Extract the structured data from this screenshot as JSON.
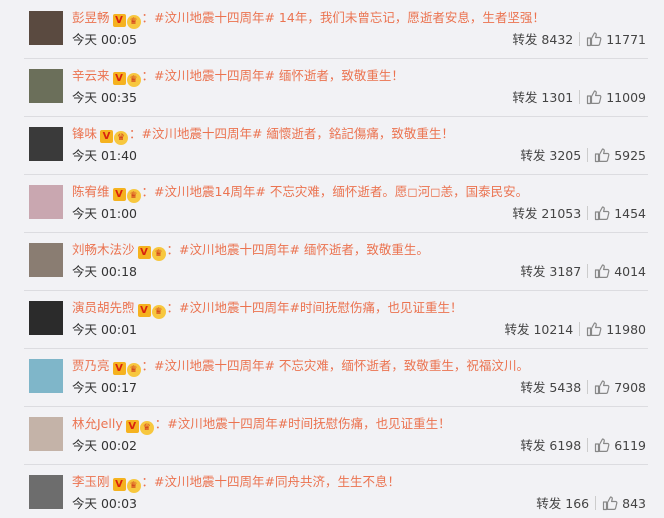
{
  "comments": [
    {
      "name": "彭昱畅",
      "text": "：#汶川地震十四周年# 14年，我们未曾忘记，愿逝者安息，生者坚强！",
      "time": "今天 00:05",
      "repost_label": "转发",
      "reposts": "8432",
      "likes": "11771",
      "avatar_color": "#5a4a40"
    },
    {
      "name": "辛云来",
      "text": "：#汶川地震十四周年# 缅怀逝者，致敬重生！",
      "time": "今天 00:35",
      "repost_label": "转发",
      "reposts": "1301",
      "likes": "11009",
      "avatar_color": "#6b6f5a"
    },
    {
      "name": "锋味",
      "text": "：#汶川地震十四周年# 緬懷逝者，銘記傷痛，致敬重生！",
      "time": "今天 01:40",
      "repost_label": "转发",
      "reposts": "3205",
      "likes": "5925",
      "avatar_color": "#3a3a3a"
    },
    {
      "name": "陈宥维",
      "text": "：#汶川地震14周年# 不忘灾难，缅怀逝者。愿◻河◻恙，国泰民安。",
      "time": "今天 01:00",
      "repost_label": "转发",
      "reposts": "21053",
      "likes": "1454",
      "avatar_color": "#c9a7b0"
    },
    {
      "name": "刘畅木法沙",
      "text": "：#汶川地震十四周年# 缅怀逝者，致敬重生。",
      "time": "今天 00:18",
      "repost_label": "转发",
      "reposts": "3187",
      "likes": "4014",
      "avatar_color": "#8a7d72"
    },
    {
      "name": "演员胡先煦",
      "text": "：#汶川地震十四周年#时间抚慰伤痛，也见证重生！",
      "time": "今天 00:01",
      "repost_label": "转发",
      "reposts": "10214",
      "likes": "11980",
      "avatar_color": "#2b2b2b"
    },
    {
      "name": "贾乃亮",
      "text": "：#汶川地震十四周年# 不忘灾难，缅怀逝者，致敬重生，祝福汶川。",
      "time": "今天 00:17",
      "repost_label": "转发",
      "reposts": "5438",
      "likes": "7908",
      "avatar_color": "#7fb6c9"
    },
    {
      "name": "林允Jelly",
      "text": "：#汶川地震十四周年#时间抚慰伤痛，也见证重生！",
      "time": "今天 00:02",
      "repost_label": "转发",
      "reposts": "6198",
      "likes": "6119",
      "avatar_color": "#c4b3a8"
    },
    {
      "name": "李玉刚",
      "text": "：#汶川地震十四周年#同舟共济，生生不息！",
      "time": "今天 00:03",
      "repost_label": "转发",
      "reposts": "166",
      "likes": "843",
      "avatar_color": "#6d6d6d"
    }
  ],
  "colors": {
    "name": "#eb7350",
    "tag": "#eb7350",
    "background": "#f2f2f5"
  },
  "icons": {
    "verified": "verified-v-icon",
    "member": "member-crown-icon",
    "like": "thumbs-up-icon"
  }
}
